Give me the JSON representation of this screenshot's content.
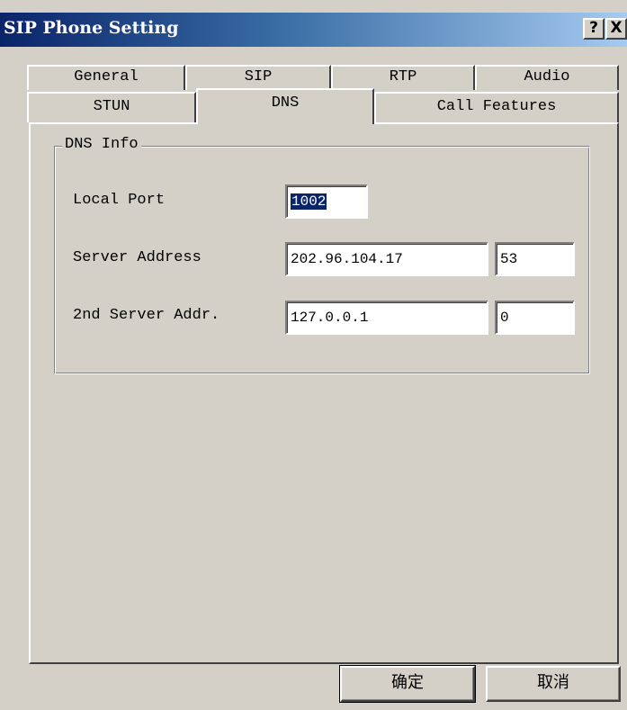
{
  "window": {
    "title": "SIP Phone Setting",
    "help_glyph": "?",
    "close_glyph": "X"
  },
  "tabs": {
    "row1": [
      {
        "label": "General",
        "selected": false
      },
      {
        "label": "SIP",
        "selected": false
      },
      {
        "label": "RTP",
        "selected": false
      },
      {
        "label": "Audio",
        "selected": false
      }
    ],
    "row2": [
      {
        "label": "STUN",
        "selected": false
      },
      {
        "label": "DNS",
        "selected": true
      },
      {
        "label": "Call Features",
        "selected": false
      }
    ]
  },
  "dns_info": {
    "group_title": "DNS Info",
    "local_port": {
      "label": "Local Port",
      "value": "1002"
    },
    "server_address": {
      "label": "Server Address",
      "value": "202.96.104.17",
      "port": "53"
    },
    "second_server": {
      "label": "2nd Server Addr.",
      "value": "127.0.0.1",
      "port": "0"
    }
  },
  "buttons": {
    "ok": "确定",
    "cancel": "取消"
  },
  "colors": {
    "titlebar_start": "#0a246a",
    "titlebar_end": "#a6caf0",
    "face": "#d4d0c8"
  }
}
